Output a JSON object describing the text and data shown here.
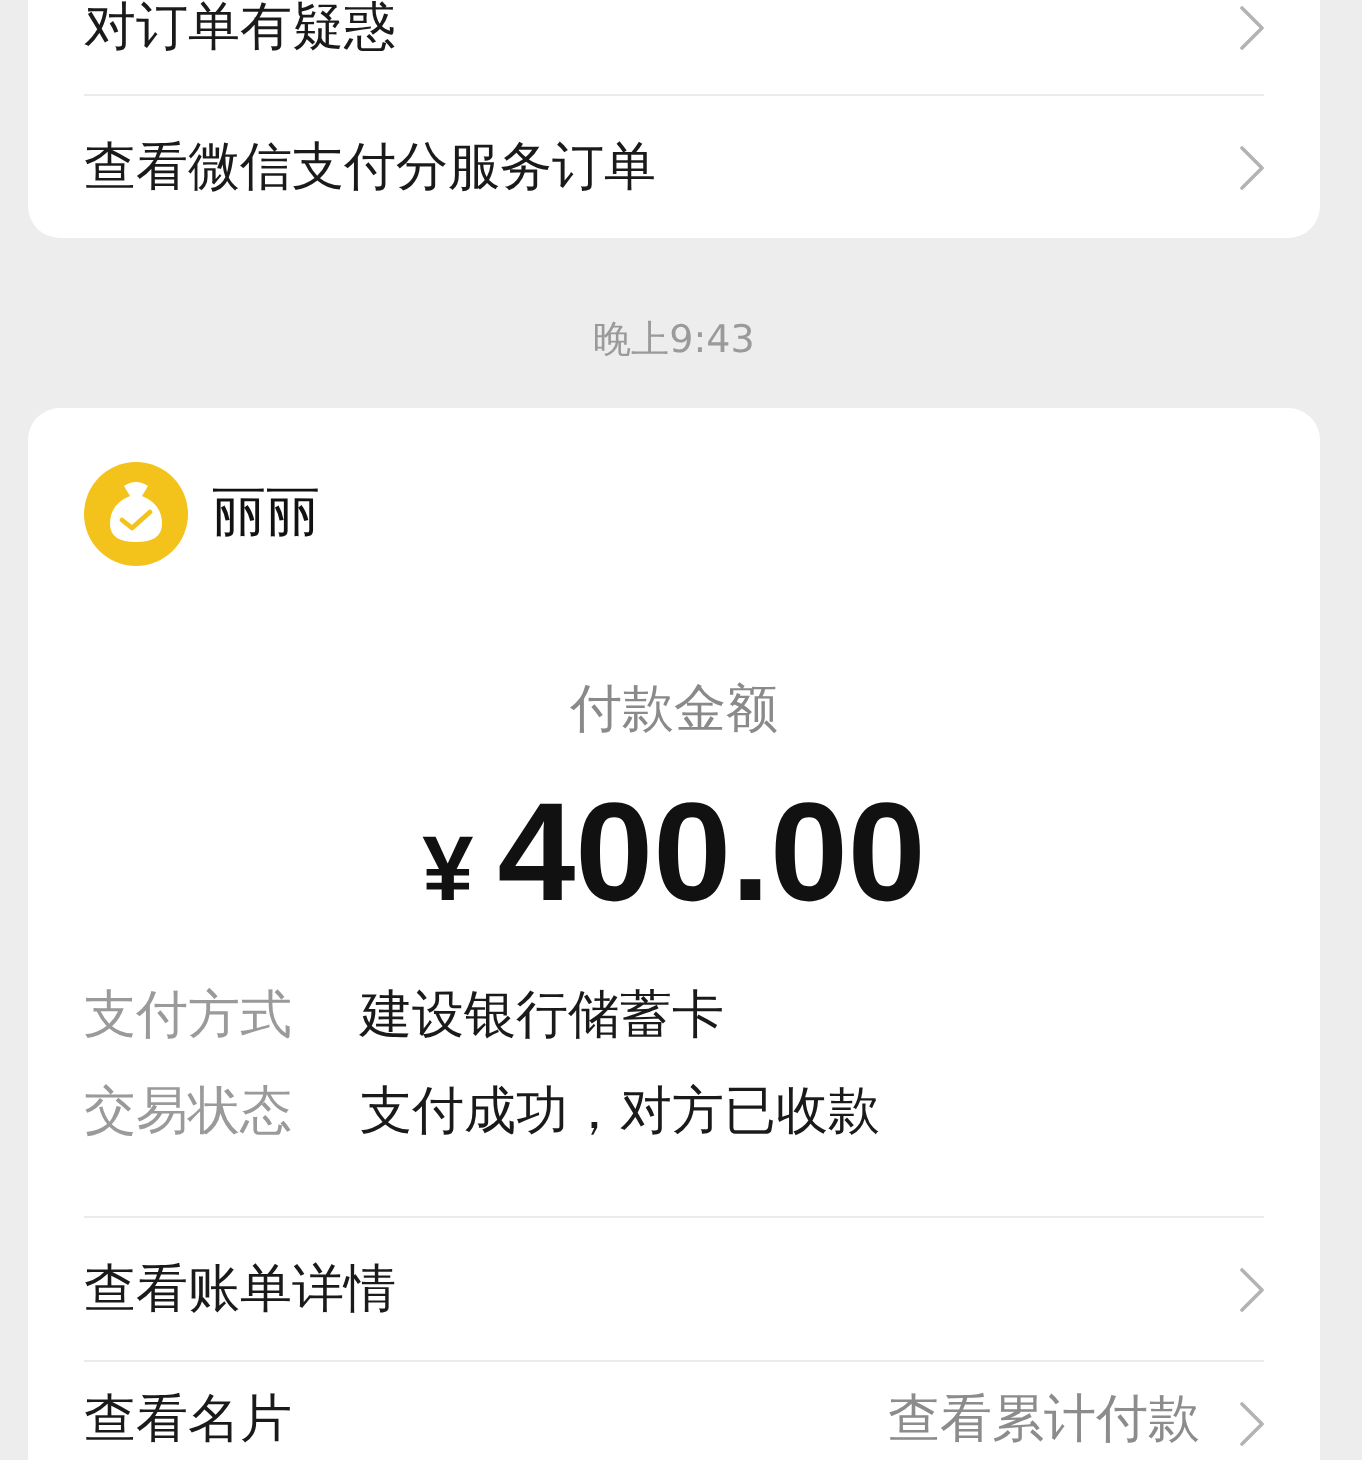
{
  "order_help_card": {
    "rows": [
      {
        "label": "对订单有疑惑"
      },
      {
        "label": "查看微信支付分服务订单"
      }
    ]
  },
  "timestamp": "晚上9:43",
  "payment_card": {
    "payee": {
      "name": "丽丽"
    },
    "amount_label": "付款金额",
    "currency": "¥",
    "amount": "400.00",
    "details": [
      {
        "label": "支付方式",
        "value": "建设银行储蓄卡"
      },
      {
        "label": "交易状态",
        "value": "支付成功，对方已收款"
      }
    ],
    "links": [
      {
        "label": "查看账单详情"
      },
      {
        "label": "查看名片",
        "secondary": "查看累计付款"
      }
    ]
  }
}
